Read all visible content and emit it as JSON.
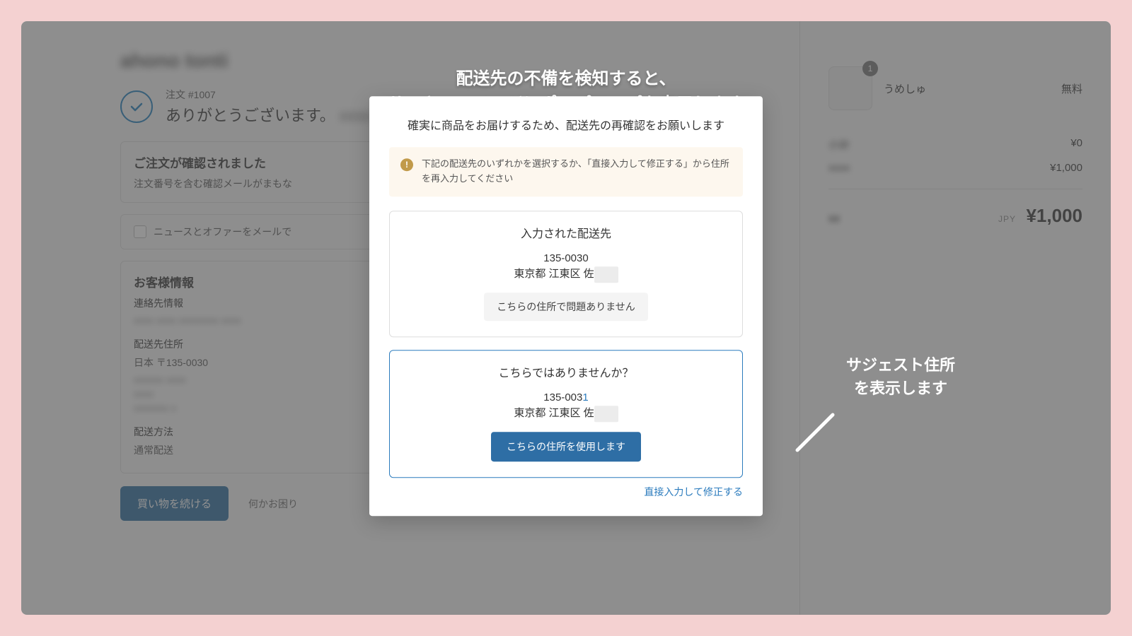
{
  "store_name_placeholder": "ahono tonti",
  "order": {
    "label": "注文 #1007",
    "thank_you": "ありがとうございます。"
  },
  "confirmation": {
    "title": "ご注文が確認されました",
    "body": "注文番号を含む確認メールがまもな"
  },
  "newsletter_label": "ニュースとオファーをメールで",
  "customer_info": {
    "title": "お客様情報",
    "contact_label": "連絡先情報",
    "shipping_address_label": "配送先住所",
    "shipping_country_line": "日本 〒135-0030",
    "shipping_method_label": "配送方法",
    "shipping_method_value": "通常配送"
  },
  "actions": {
    "continue_shopping": "買い物を続ける",
    "trouble": "何かお困り"
  },
  "side": {
    "item": {
      "qty": "1",
      "name": "うめしゅ",
      "price": "無料"
    },
    "subtotal_label": "小計",
    "subtotal_value": "¥0",
    "shipping_value": "¥1,000",
    "total_currency": "JPY",
    "total_value": "¥1,000"
  },
  "modal": {
    "title": "確実に商品をお届けするため、配送先の再確認をお願いします",
    "notice": "下記の配送先のいずれかを選択するか、「直接入力して修正する」から住所を再入力してください",
    "entered": {
      "heading": "入力された配送先",
      "postal": "135-0030",
      "line": "東京都 江東区 佐",
      "button": "こちらの住所で問題ありません"
    },
    "suggested": {
      "heading": "こちらではありませんか？",
      "postal_prefix": "135-003",
      "postal_hl": "1",
      "line": "東京都 江東区 佐",
      "button": "こちらの住所を使用します"
    },
    "edit_link": "直接入力して修正する"
  },
  "captions": {
    "top_line1": "配送先の不備を検知すると、",
    "top_line2": "サンキューページにポップアップを表示します",
    "side_line1": "サジェスト住所",
    "side_line2": "を表示します"
  }
}
